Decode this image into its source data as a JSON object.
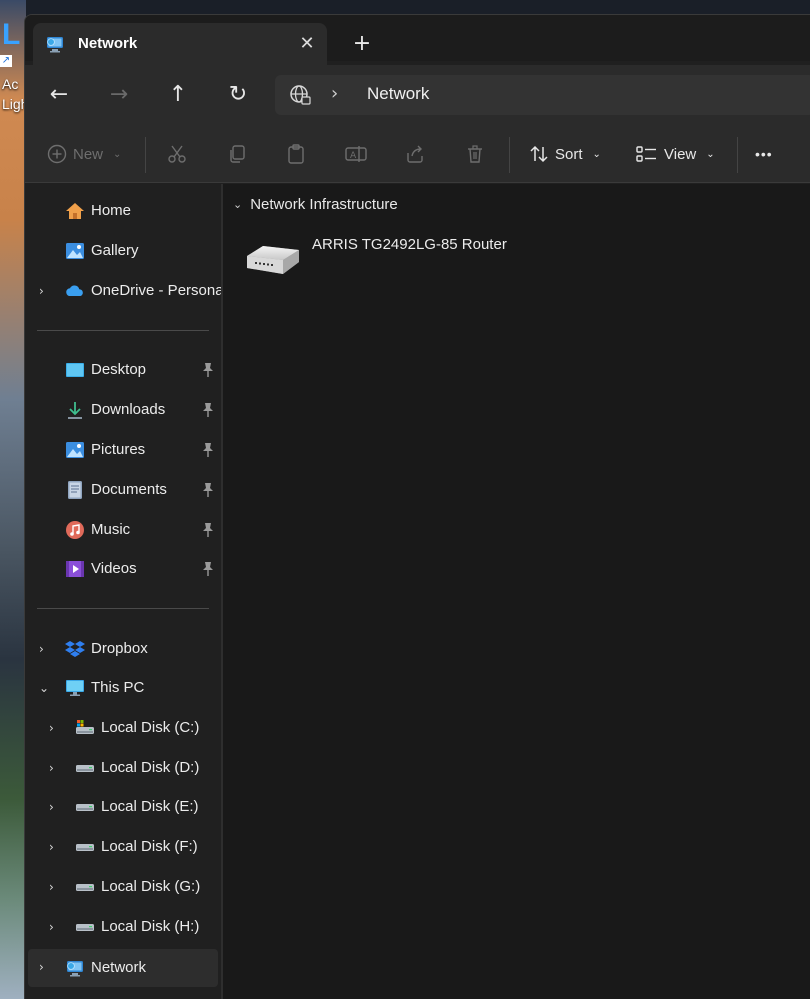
{
  "desktop": {
    "icon_letter": "L",
    "label_line1": "Ac",
    "label_line2": "Ligh"
  },
  "tab": {
    "title": "Network",
    "close_glyph": "✕",
    "new_glyph": "+"
  },
  "nav": {
    "back_glyph": "←",
    "forward_glyph": "→",
    "up_glyph": "↑",
    "refresh_glyph": "↻",
    "separator_glyph": "›",
    "address": "Network"
  },
  "toolbar": {
    "new_label": "New",
    "sort_label": "Sort",
    "view_label": "View",
    "more_glyph": "•••"
  },
  "sidebar": {
    "quick": [
      {
        "label": "Home",
        "icon": "home-icon"
      },
      {
        "label": "Gallery",
        "icon": "gallery-icon"
      },
      {
        "label": "OneDrive - Persona",
        "icon": "onedrive-icon"
      }
    ],
    "pinned": [
      {
        "label": "Desktop",
        "icon": "desktop-folder-icon"
      },
      {
        "label": "Downloads",
        "icon": "downloads-icon"
      },
      {
        "label": "Pictures",
        "icon": "pictures-icon"
      },
      {
        "label": "Documents",
        "icon": "documents-icon"
      },
      {
        "label": "Music",
        "icon": "music-icon"
      },
      {
        "label": "Videos",
        "icon": "videos-icon"
      }
    ],
    "drives": [
      {
        "label": "Dropbox",
        "icon": "dropbox-icon"
      },
      {
        "label": "This PC",
        "icon": "this-pc-icon"
      },
      {
        "label": "Local Disk (C:)",
        "icon": "system-disk-icon"
      },
      {
        "label": "Local Disk (D:)",
        "icon": "disk-icon"
      },
      {
        "label": "Local Disk (E:)",
        "icon": "disk-icon"
      },
      {
        "label": "Local Disk (F:)",
        "icon": "disk-icon"
      },
      {
        "label": "Local Disk (G:)",
        "icon": "disk-icon"
      },
      {
        "label": "Local Disk (H:)",
        "icon": "disk-icon"
      },
      {
        "label": "Network",
        "icon": "network-icon"
      }
    ]
  },
  "content": {
    "group_title": "Network Infrastructure",
    "device_label": "ARRIS TG2492LG-85 Router",
    "device_icon": "router-icon"
  },
  "colors": {
    "window_bg": "#202020",
    "toolbar_bg": "#2b2b2b",
    "content_bg": "#191919",
    "accent": "#4aa3ff"
  }
}
